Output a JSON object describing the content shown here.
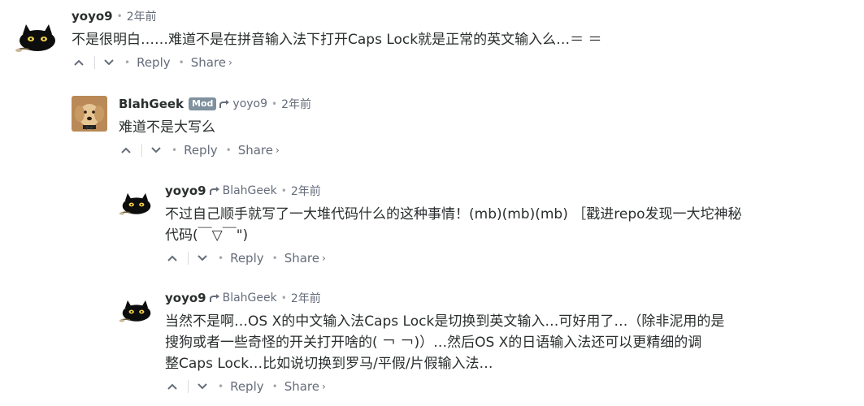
{
  "comments": [
    {
      "author": "yoyo9",
      "time": "2年前",
      "text": [
        "不是很明白……难道不是在拼音输入法下打开Caps Lock就是正常的英文输入么…＝ ＝"
      ],
      "reply_label": "Reply",
      "share_label": "Share"
    },
    {
      "author": "BlahGeek",
      "badge": "Mod",
      "parent": "yoyo9",
      "time": "2年前",
      "text": [
        "难道不是大写么"
      ],
      "reply_label": "Reply",
      "share_label": "Share"
    },
    {
      "author": "yoyo9",
      "parent": "BlahGeek",
      "time": "2年前",
      "text": [
        "不过自己顺手就写了一大堆代码什么的这种事情！(mb)(mb)(mb) ［戳进repo发现一大坨神秘",
        "代码(￣▽￣\")"
      ],
      "reply_label": "Reply",
      "share_label": "Share"
    },
    {
      "author": "yoyo9",
      "parent": "BlahGeek",
      "time": "2年前",
      "text": [
        "当然不是啊…OS X的中文输入法Caps Lock是切换到英文输入…可好用了…（除非泥用的是",
        "搜狗或者一些奇怪的开关打开啥的( ￢ ￢)）…然后OS X的日语输入法还可以更精细的调",
        "整Caps Lock…比如说切换到罗马/平假/片假输入法…"
      ],
      "reply_label": "Reply",
      "share_label": "Share"
    }
  ],
  "icons": {
    "upvote": "upvote-icon",
    "downvote": "downvote-icon",
    "reply_arrow": "reply-arrow-icon",
    "share_chevron": "chevron-right-icon"
  },
  "colors": {
    "text": "#2a2e2e",
    "muted": "#656c7a",
    "badge": "#7f919e"
  }
}
